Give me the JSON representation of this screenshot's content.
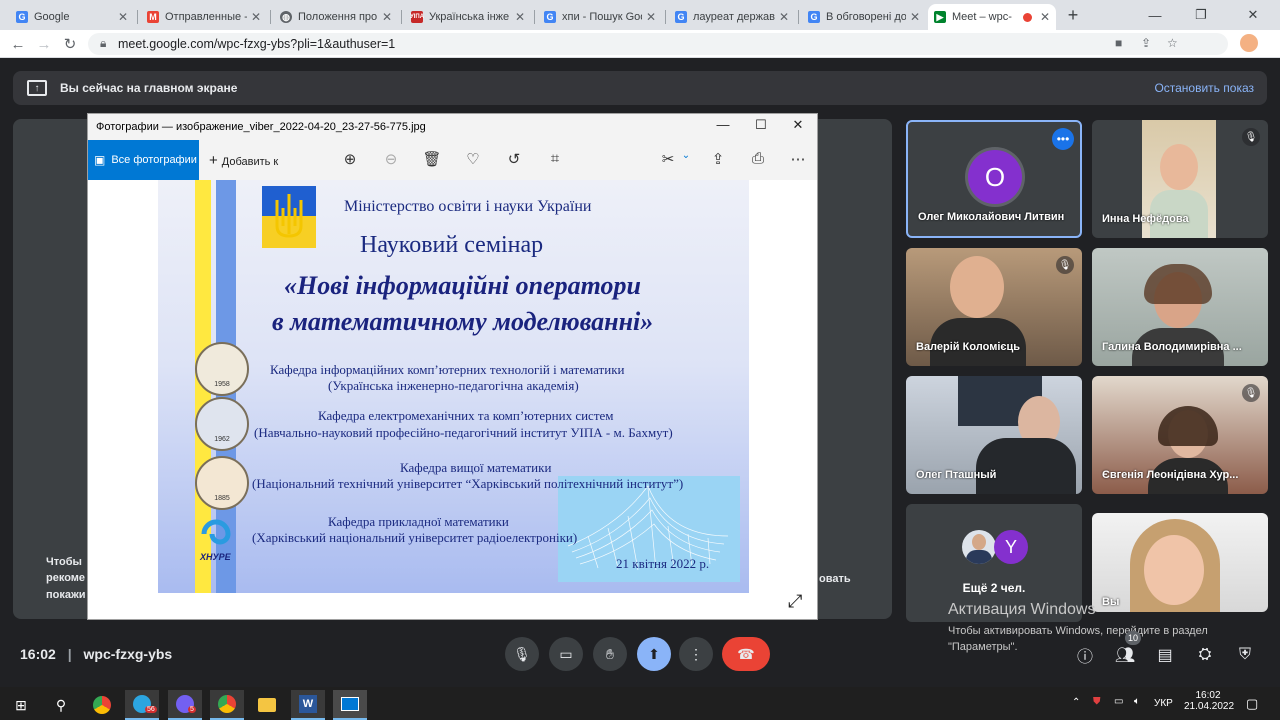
{
  "browser": {
    "tabs": [
      {
        "title": "Google",
        "icon": "google-icon"
      },
      {
        "title": "Отправленные -",
        "icon": "gmail-icon"
      },
      {
        "title": "Положення про",
        "icon": "globe-icon"
      },
      {
        "title": "Українська інже",
        "icon": "uipa-icon"
      },
      {
        "title": "хпи - Пошук Goo",
        "icon": "google-icon"
      },
      {
        "title": "лауреат держав",
        "icon": "google-icon"
      },
      {
        "title": "В обговорені до",
        "icon": "google-icon"
      },
      {
        "title": "Meet – wpc-",
        "icon": "meet-icon"
      }
    ],
    "url": "meet.google.com/wpc-fzxg-ybs?pli=1&authuser=1"
  },
  "meet": {
    "presenting_text": "Вы сейчас на главном экране",
    "stop_label": "Остановить показ",
    "under_text": [
      "Чтобы",
      "рекоме",
      "покажи",
      "овать"
    ],
    "time": "16:02",
    "code": "wpc-fzxg-ybs",
    "people_count": "10",
    "participants": [
      {
        "name": "Олег Миколайович Литвин",
        "initial": "О",
        "color": "#8430ce"
      },
      {
        "name": "Инна Нефёдова"
      },
      {
        "name": "Валерій Коломієць"
      },
      {
        "name": "Галина Володимирівна ..."
      },
      {
        "name": "Олег Пташный"
      },
      {
        "name": "Євгенія Леонідівна Хур..."
      },
      {
        "name": "Ещё 2 чел.",
        "initial": "Y"
      },
      {
        "name": "Вы"
      }
    ]
  },
  "photos": {
    "window_title": "Фотографии — изображение_viber_2022-04-20_23-27-56-775.jpg",
    "all_photos": "Все фотографии",
    "add_to": "Добавить к"
  },
  "slide": {
    "ministry": "Міністерство освіти і науки України",
    "seminar": "Науковий семінар",
    "title_line1": "«Нові інформаційні оператори",
    "title_line2": "в математичному моделюванні»",
    "departments": [
      {
        "name": "Кафедра інформаційних комп’ютерних технологій і математики",
        "org": "(Українська інженерно-педагогічна академія)"
      },
      {
        "name": "Кафедра електромеханічних та комп’ютерних систем",
        "org": "(Навчально-науковий професійно-педагогічний інститут УІПА - м. Бахмут)"
      },
      {
        "name": "Кафедра вищої математики",
        "org": "(Національний технічний університет “Харківський політехнічний інститут”)"
      },
      {
        "name": "Кафедра прикладної математики",
        "org": "(Харківський національний університет радіоелектроніки)"
      }
    ],
    "seal_years": [
      "1958",
      "1962",
      "1885"
    ],
    "seal_text": "УІПА",
    "khnure": "ХНУРЕ",
    "date": "21 квітня 2022 р."
  },
  "windows": {
    "activation_title": "Активация Windows",
    "activation_text1": "Чтобы активировать Windows, перейдите в раздел",
    "activation_text2": "\"Параметры\".",
    "lang": "УКР",
    "clock_time": "16:02",
    "clock_date": "21.04.2022",
    "telegram_badge": "56",
    "viber_badge": "5"
  }
}
